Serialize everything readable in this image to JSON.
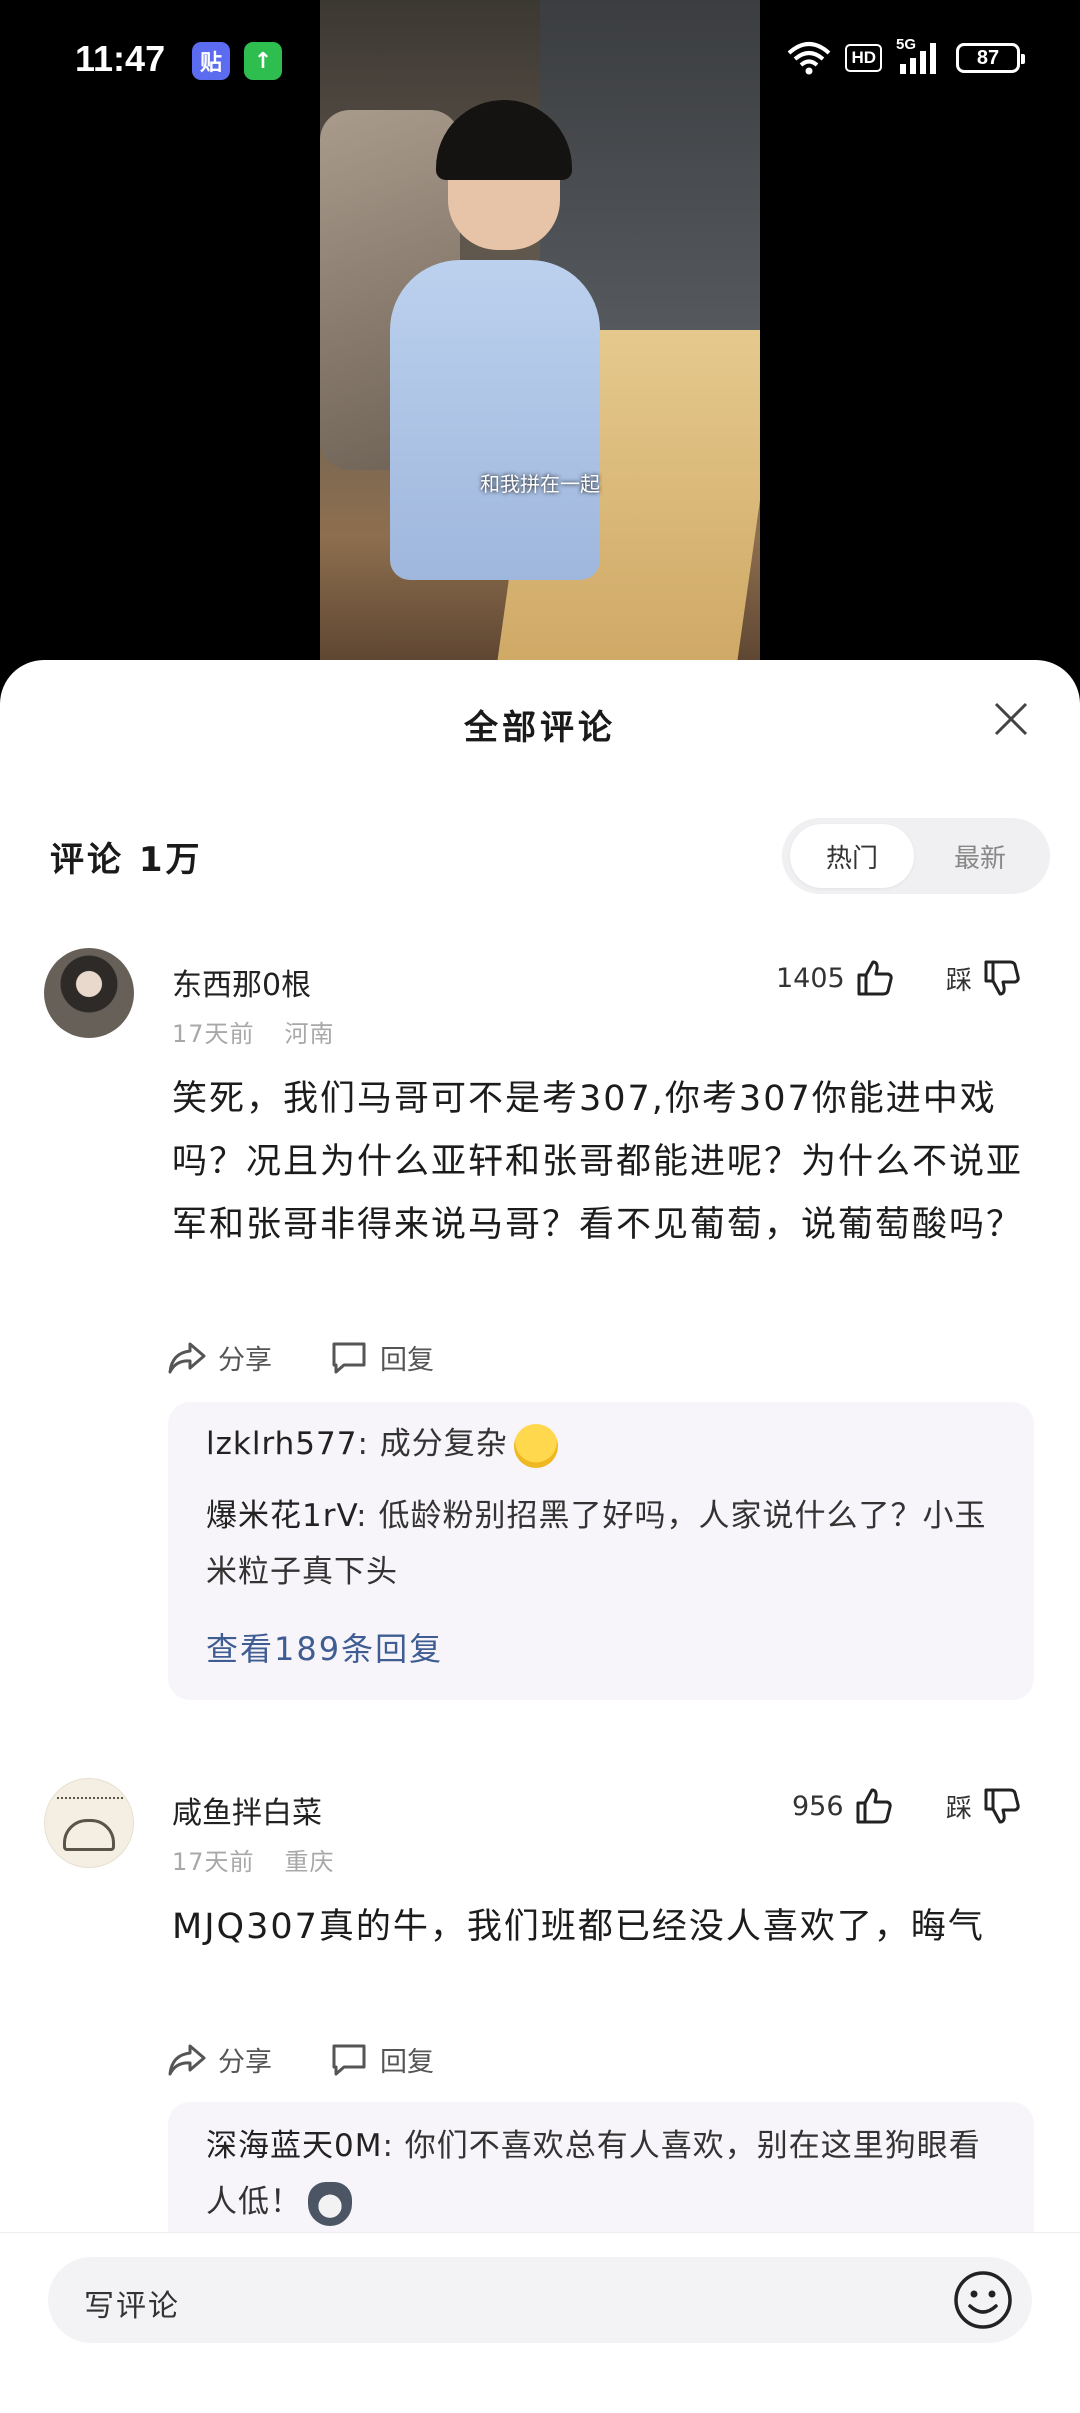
{
  "status_bar": {
    "time": "11:47",
    "app_icon_1": "贴",
    "app_icon_2": "↑",
    "network": "HD",
    "network_gen": "5G",
    "battery": "87"
  },
  "video": {
    "subtitle": "和我拼在一起"
  },
  "sheet": {
    "title": "全部评论",
    "comment_count": "评论 1万",
    "sort_tabs": [
      "热门",
      "最新"
    ]
  },
  "comments": [
    {
      "username": "东西那0根",
      "time": "17天前",
      "location": "河南",
      "like_count": "1405",
      "dislike_label": "踩",
      "text": "笑死，我们马哥可不是考307,你考307你能进中戏吗？况且为什么亚轩和张哥都能进呢？为什么不说亚军和张哥非得来说马哥？看不见葡萄，说葡萄酸吗？",
      "share_label": "分享",
      "reply_label": "回复",
      "replies": [
        {
          "name": "lzklrh577",
          "text": "成分复杂"
        },
        {
          "name": "爆米花1rV",
          "text": "低龄粉别招黑了好吗，人家说什么了？小玉米粒子真下头"
        }
      ],
      "view_more": "查看189条回复"
    },
    {
      "username": "咸鱼拌白菜",
      "time": "17天前",
      "location": "重庆",
      "like_count": "956",
      "dislike_label": "踩",
      "text": "MJQ307真的牛，我们班都已经没人喜欢了，晦气",
      "share_label": "分享",
      "reply_label": "回复",
      "replies": [
        {
          "name": "深海蓝天0M",
          "text": "你们不喜欢总有人喜欢，别在这里狗眼看人低！"
        }
      ]
    }
  ],
  "input": {
    "placeholder": "写评论"
  },
  "colors": {
    "link_blue": "#3f5d92",
    "reply_bg": "#f7f5f9",
    "meta_gray": "#a8a8a8"
  }
}
